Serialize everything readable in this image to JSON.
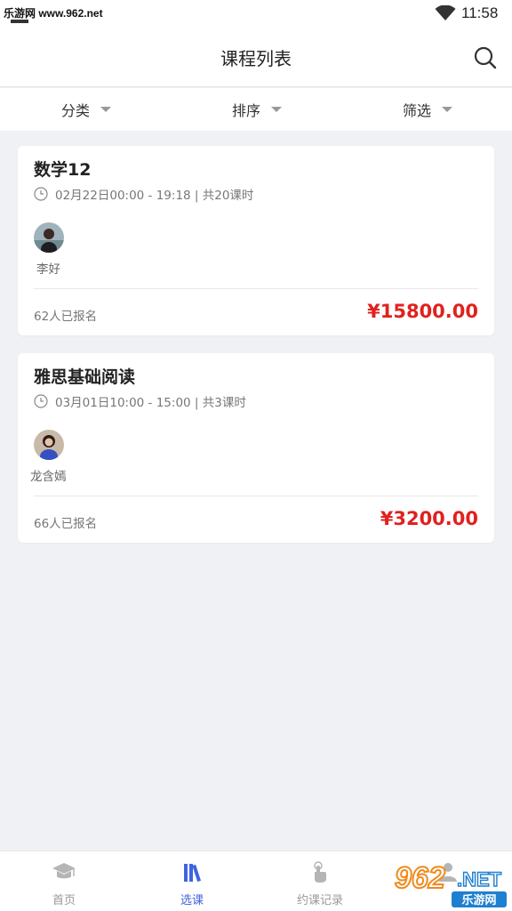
{
  "status_bar": {
    "watermark": "乐游网 www.962.net",
    "time": "11:58",
    "wifi_icon": "wifi-icon"
  },
  "header": {
    "title": "课程列表",
    "search_icon": "search-icon"
  },
  "filters": [
    {
      "label": "分类"
    },
    {
      "label": "排序"
    },
    {
      "label": "筛选"
    }
  ],
  "courses": [
    {
      "title": "数学12",
      "schedule": "02月22日00:00 - 19:18 | 共20课时",
      "teacher": "李好",
      "enrolled": "62人已报名",
      "price": "¥15800.00"
    },
    {
      "title": "雅思基础阅读",
      "schedule": "03月01日10:00 - 15:00 | 共3课时",
      "teacher": "龙含嫣",
      "enrolled": "66人已报名",
      "price": "¥3200.00"
    }
  ],
  "bottom_nav": [
    {
      "label": "首页",
      "icon": "graduation-cap-icon",
      "active": false
    },
    {
      "label": "选课",
      "icon": "books-icon",
      "active": true
    },
    {
      "label": "约课记录",
      "icon": "hand-tap-icon",
      "active": false
    },
    {
      "label": "",
      "icon": "user-icon",
      "active": false
    }
  ],
  "logo": {
    "digits": "962",
    "suffix": ".NET",
    "name": "乐游网"
  },
  "colors": {
    "price": "#e0211f",
    "active_nav": "#3f63e0",
    "background": "#f0f1f5"
  }
}
